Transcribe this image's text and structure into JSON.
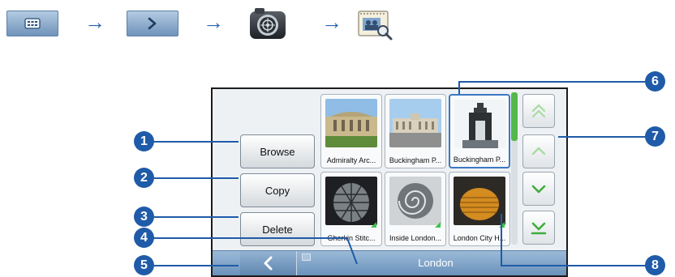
{
  "nav_path": {
    "steps": [
      "main-menu-button",
      "next-button",
      "camera-app-icon",
      "photo-album-icon"
    ],
    "arrow": "→"
  },
  "screen": {
    "buttons": {
      "browse": "Browse",
      "copy": "Copy",
      "delete": "Delete"
    },
    "thumbnails": [
      {
        "caption": "Admiralty Arc...",
        "selected": false,
        "checked": false
      },
      {
        "caption": "Buckingham P...",
        "selected": false,
        "checked": false
      },
      {
        "caption": "Buckingham P...",
        "selected": true,
        "checked": false
      },
      {
        "caption": "Gherkin Stitc...",
        "selected": false,
        "checked": true
      },
      {
        "caption": "Inside London...",
        "selected": false,
        "checked": true
      },
      {
        "caption": "London City H...",
        "selected": false,
        "checked": true
      }
    ],
    "footer": {
      "title": "London",
      "back_icon": "chevron-left-icon"
    },
    "scroll_buttons": [
      "first-page-icon",
      "page-up-icon",
      "page-down-icon",
      "last-page-icon"
    ]
  },
  "callouts": [
    "1",
    "2",
    "3",
    "4",
    "5",
    "6",
    "7",
    "8"
  ],
  "colors": {
    "accent": "#1f5ba8",
    "bar": "#7ba0c6",
    "check": "#3cc44a",
    "chevron": "#52b948"
  }
}
